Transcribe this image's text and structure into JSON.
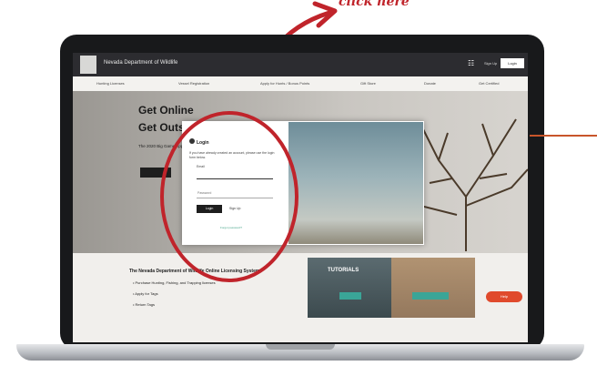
{
  "annotation": {
    "text": "click here"
  },
  "site": {
    "title": "Nevada Department of Wildlife",
    "header": {
      "signup": "Sign Up",
      "login": "Login"
    },
    "nav": [
      "Hunting Licenses",
      "Vessel Registration",
      "Apply for Hunts / Bonus Points",
      "Gift Store",
      "Donate",
      "Get Certified"
    ]
  },
  "hero": {
    "line1": "Get Online",
    "line2": "Get Outside",
    "sub": "The 2020 Big Game Application period is now open"
  },
  "login_modal": {
    "title": "Login",
    "description": "If you have already created an account, please use the login form below.",
    "email_label": "Email",
    "password_placeholder": "Password",
    "login_button": "Login",
    "signup_link": "Sign Up",
    "forgot_link": "Forgot password?"
  },
  "lower": {
    "title": "The Nevada Department of Wildlife Online Licensing System:",
    "bullets": [
      "Purchase Hunting, Fishing, and Trapping licenses",
      "Apply for Tags",
      "Return Tags"
    ]
  },
  "tutorials": {
    "title": "TUTORIALS"
  },
  "help_button": "Help"
}
